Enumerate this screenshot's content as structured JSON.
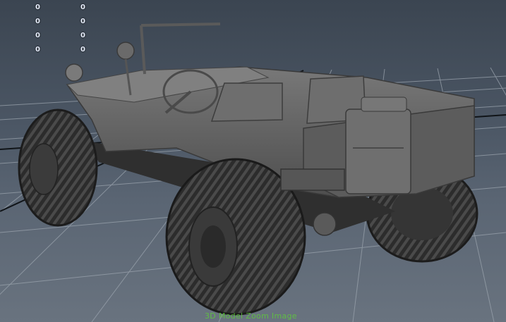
{
  "viewport": {
    "hud": {
      "column_1": [
        "0",
        "0",
        "0",
        "0"
      ],
      "column_2": [
        "0",
        "0",
        "0",
        "0"
      ]
    },
    "watermark": "3D Model Zoom Image",
    "colors": {
      "background_top": "#3b4551",
      "background_bottom": "#69737f",
      "grid_line": "#9aa3ad",
      "grid_axis": "#101418",
      "model_gray": "#6a6a6a",
      "hud_text": "#e9f0ff",
      "watermark_text": "#5ec93a"
    },
    "model_name": "",
    "icons": [
      "grid-plane-icon"
    ]
  }
}
